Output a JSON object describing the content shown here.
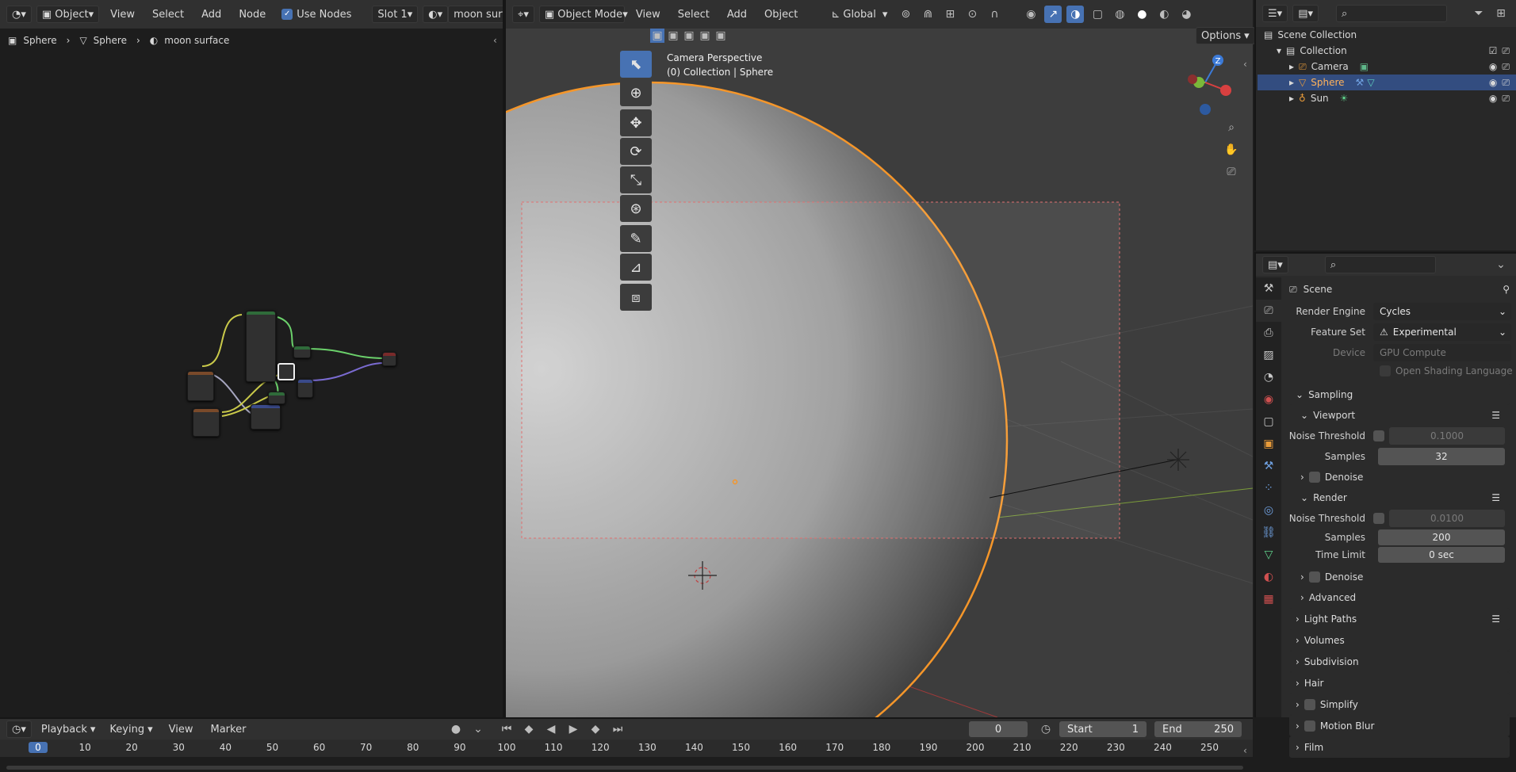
{
  "node_editor": {
    "editor_type": "Object",
    "menus": [
      "View",
      "Select",
      "Add",
      "Node"
    ],
    "use_nodes_label": "Use Nodes",
    "slot": "Slot 1",
    "material": "moon surface",
    "breadcrumb": [
      "Sphere",
      "Sphere",
      "moon surface"
    ]
  },
  "viewport": {
    "mode": "Object Mode",
    "menus": [
      "View",
      "Select",
      "Add",
      "Object"
    ],
    "transform_orientation": "Global",
    "options_label": "Options",
    "overlay_title": "Camera Perspective",
    "overlay_subtitle": "(0) Collection | Sphere",
    "gizmo_axes": [
      "Z"
    ]
  },
  "outliner": {
    "scene_collection": "Scene Collection",
    "collection": "Collection",
    "items": [
      {
        "name": "Camera",
        "selected": false
      },
      {
        "name": "Sphere",
        "selected": true
      },
      {
        "name": "Sun",
        "selected": false
      }
    ]
  },
  "properties": {
    "scene_label": "Scene",
    "render_engine_label": "Render Engine",
    "render_engine": "Cycles",
    "feature_set_label": "Feature Set",
    "feature_set": "Experimental",
    "device_label": "Device",
    "device": "GPU Compute",
    "osl_label": "Open Shading Language",
    "sampling": "Sampling",
    "viewport": "Viewport",
    "noise_threshold_label": "Noise Threshold",
    "viewport_noise_threshold": "0.1000",
    "samples_label": "Samples",
    "viewport_samples": "32",
    "denoise_label": "Denoise",
    "render": "Render",
    "render_noise_threshold": "0.0100",
    "render_samples": "200",
    "time_limit_label": "Time Limit",
    "time_limit": "0 sec",
    "advanced": "Advanced",
    "collapsed_panels": [
      "Light Paths",
      "Volumes",
      "Subdivision",
      "Hair",
      "Simplify",
      "Motion Blur",
      "Film"
    ]
  },
  "timeline": {
    "menus": [
      "Playback",
      "Keying",
      "View",
      "Marker"
    ],
    "current_frame": "0",
    "start_label": "Start",
    "start": "1",
    "end_label": "End",
    "end": "250",
    "ticks": [
      "0",
      "10",
      "20",
      "30",
      "40",
      "50",
      "60",
      "70",
      "80",
      "90",
      "100",
      "110",
      "120",
      "130",
      "140",
      "150",
      "160",
      "170",
      "180",
      "190",
      "200",
      "210",
      "220",
      "230",
      "240",
      "250"
    ]
  },
  "colors": {
    "accent_blue": "#4772b3",
    "selection_orange": "#f5962a",
    "header_bg": "#303030"
  }
}
